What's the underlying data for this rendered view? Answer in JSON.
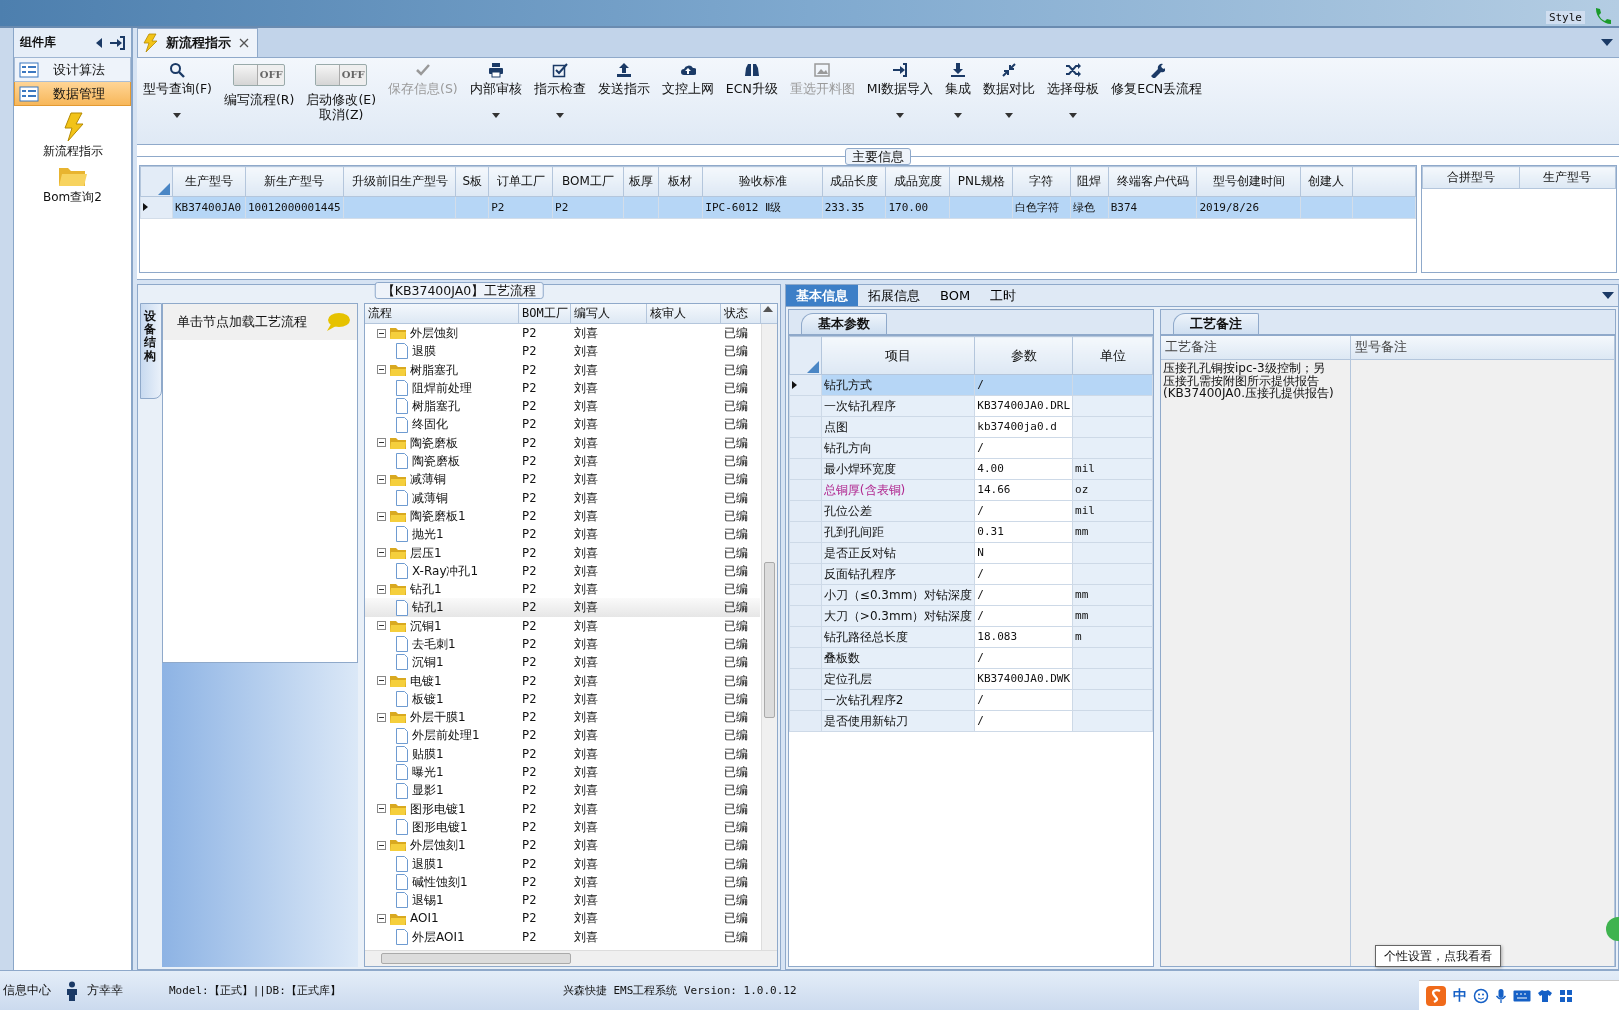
{
  "top_bar": {
    "style_label": "Style"
  },
  "sidebar": {
    "title": "组件库",
    "items": [
      {
        "label": "设计算法",
        "selected": false
      },
      {
        "label": "数据管理",
        "selected": true
      }
    ],
    "shortcuts": [
      {
        "label": "新流程指示"
      },
      {
        "label": "Bom查询2"
      }
    ]
  },
  "document_tab": {
    "title": "新流程指示"
  },
  "toolbar": [
    {
      "kind": "button",
      "label": "型号查询(F)",
      "dropdown": true,
      "disabled": false
    },
    {
      "kind": "toggle",
      "label": "编写流程(R)",
      "on": false,
      "toggle_text": "OFF"
    },
    {
      "kind": "toggle",
      "label": "启动修改(E)",
      "label_2": "取消(Z)",
      "on": false,
      "toggle_text": "OFF"
    },
    {
      "kind": "button",
      "label": "保存信息(S)",
      "dropdown": false,
      "disabled": true
    },
    {
      "kind": "button",
      "label": "内部审核",
      "dropdown": true,
      "disabled": false
    },
    {
      "kind": "button",
      "label": "指示检查",
      "dropdown": true,
      "disabled": false
    },
    {
      "kind": "button",
      "label": "发送指示",
      "dropdown": false,
      "disabled": false
    },
    {
      "kind": "button",
      "label": "文控上网",
      "dropdown": false,
      "disabled": false
    },
    {
      "kind": "button",
      "label": "ECN升级",
      "dropdown": false,
      "disabled": false
    },
    {
      "kind": "button",
      "label": "重选开料图",
      "dropdown": false,
      "disabled": true
    },
    {
      "kind": "button",
      "label": "MI数据导入",
      "dropdown": true,
      "disabled": false
    },
    {
      "kind": "button",
      "label": "集成",
      "dropdown": true,
      "disabled": false
    },
    {
      "kind": "button",
      "label": "数据对比",
      "dropdown": true,
      "disabled": false
    },
    {
      "kind": "button",
      "label": "选择母板",
      "dropdown": true,
      "disabled": false
    },
    {
      "kind": "button",
      "label": "修复ECN丢流程",
      "dropdown": false,
      "disabled": false
    }
  ],
  "main_info": {
    "title": "主要信息",
    "table": {
      "columns": [
        "生产型号",
        "新生产型号",
        "升级前旧生产型号",
        "S板",
        "订单工厂",
        "BOM工厂",
        "板厚",
        "板材",
        "验收标准",
        "成品长度",
        "成品宽度",
        "PNL规格",
        "字符",
        "阻焊",
        "终端客户代码",
        "型号创建时间",
        "创建人"
      ],
      "rows": [
        {
          "selected": true,
          "cells": [
            "KB37400JA0",
            "10012000001445",
            null,
            null,
            "P2",
            "P2",
            null,
            null,
            "IPC-6012 Ⅱ级",
            "233.35",
            "170.00",
            null,
            "白色字符",
            "绿色",
            "B374",
            "2019/8/26",
            null
          ]
        }
      ]
    },
    "merge_table": {
      "columns": [
        "合拼型号",
        "生产型号"
      ]
    }
  },
  "process_panel": {
    "title": "【KB37400JA0】工艺流程",
    "side_tab": "设备结构",
    "hint": "单击节点加载工艺流程",
    "tree": {
      "columns": [
        "流程",
        "BOM工厂",
        "编写人",
        "核审人",
        "状态"
      ],
      "nodes": [
        {
          "name": "外层蚀刻",
          "bom_factory": "P2",
          "writer": "刘喜",
          "status": "已编",
          "expanded": true,
          "selected": false,
          "children": [
            {
              "name": "退膜",
              "bom_factory": "P2",
              "writer": "刘喜",
              "status": "已编",
              "selected": false
            }
          ]
        },
        {
          "name": "树脂塞孔",
          "bom_factory": "P2",
          "writer": "刘喜",
          "status": "已编",
          "expanded": true,
          "selected": false,
          "children": [
            {
              "name": "阻焊前处理",
              "bom_factory": "P2",
              "writer": "刘喜",
              "status": "已编",
              "selected": false
            },
            {
              "name": "树脂塞孔",
              "bom_factory": "P2",
              "writer": "刘喜",
              "status": "已编",
              "selected": false
            },
            {
              "name": "终固化",
              "bom_factory": "P2",
              "writer": "刘喜",
              "status": "已编",
              "selected": false
            }
          ]
        },
        {
          "name": "陶瓷磨板",
          "bom_factory": "P2",
          "writer": "刘喜",
          "status": "已编",
          "expanded": true,
          "selected": false,
          "children": [
            {
              "name": "陶瓷磨板",
              "bom_factory": "P2",
              "writer": "刘喜",
              "status": "已编",
              "selected": false
            }
          ]
        },
        {
          "name": "减薄铜",
          "bom_factory": "P2",
          "writer": "刘喜",
          "status": "已编",
          "expanded": true,
          "selected": false,
          "children": [
            {
              "name": "减薄铜",
              "bom_factory": "P2",
              "writer": "刘喜",
              "status": "已编",
              "selected": false
            }
          ]
        },
        {
          "name": "陶瓷磨板1",
          "bom_factory": "P2",
          "writer": "刘喜",
          "status": "已编",
          "expanded": true,
          "selected": false,
          "children": [
            {
              "name": "抛光1",
              "bom_factory": "P2",
              "writer": "刘喜",
              "status": "已编",
              "selected": false
            }
          ]
        },
        {
          "name": "层压1",
          "bom_factory": "P2",
          "writer": "刘喜",
          "status": "已编",
          "expanded": true,
          "selected": false,
          "children": [
            {
              "name": "X-Ray冲孔1",
              "bom_factory": "P2",
              "writer": "刘喜",
              "status": "已编",
              "selected": false
            }
          ]
        },
        {
          "name": "钻孔1",
          "bom_factory": "P2",
          "writer": "刘喜",
          "status": "已编",
          "expanded": true,
          "selected": false,
          "children": [
            {
              "name": "钻孔1",
              "bom_factory": "P2",
              "writer": "刘喜",
              "status": "已编",
              "selected": true
            }
          ]
        },
        {
          "name": "沉铜1",
          "bom_factory": "P2",
          "writer": "刘喜",
          "status": "已编",
          "expanded": true,
          "selected": false,
          "children": [
            {
              "name": "去毛刺1",
              "bom_factory": "P2",
              "writer": "刘喜",
              "status": "已编",
              "selected": false
            },
            {
              "name": "沉铜1",
              "bom_factory": "P2",
              "writer": "刘喜",
              "status": "已编",
              "selected": false
            }
          ]
        },
        {
          "name": "电镀1",
          "bom_factory": "P2",
          "writer": "刘喜",
          "status": "已编",
          "expanded": true,
          "selected": false,
          "children": [
            {
              "name": "板镀1",
              "bom_factory": "P2",
              "writer": "刘喜",
              "status": "已编",
              "selected": false
            }
          ]
        },
        {
          "name": "外层干膜1",
          "bom_factory": "P2",
          "writer": "刘喜",
          "status": "已编",
          "expanded": true,
          "selected": false,
          "children": [
            {
              "name": "外层前处理1",
              "bom_factory": "P2",
              "writer": "刘喜",
              "status": "已编",
              "selected": false
            },
            {
              "name": "贴膜1",
              "bom_factory": "P2",
              "writer": "刘喜",
              "status": "已编",
              "selected": false
            },
            {
              "name": "曝光1",
              "bom_factory": "P2",
              "writer": "刘喜",
              "status": "已编",
              "selected": false
            },
            {
              "name": "显影1",
              "bom_factory": "P2",
              "writer": "刘喜",
              "status": "已编",
              "selected": false
            }
          ]
        },
        {
          "name": "图形电镀1",
          "bom_factory": "P2",
          "writer": "刘喜",
          "status": "已编",
          "expanded": true,
          "selected": false,
          "children": [
            {
              "name": "图形电镀1",
              "bom_factory": "P2",
              "writer": "刘喜",
              "status": "已编",
              "selected": false
            }
          ]
        },
        {
          "name": "外层蚀刻1",
          "bom_factory": "P2",
          "writer": "刘喜",
          "status": "已编",
          "expanded": true,
          "selected": false,
          "children": [
            {
              "name": "退膜1",
              "bom_factory": "P2",
              "writer": "刘喜",
              "status": "已编",
              "selected": false
            },
            {
              "name": "碱性蚀刻1",
              "bom_factory": "P2",
              "writer": "刘喜",
              "status": "已编",
              "selected": false
            },
            {
              "name": "退锡1",
              "bom_factory": "P2",
              "writer": "刘喜",
              "status": "已编",
              "selected": false
            }
          ]
        },
        {
          "name": "AOI1",
          "bom_factory": "P2",
          "writer": "刘喜",
          "status": "已编",
          "expanded": true,
          "selected": false,
          "children": [
            {
              "name": "外层AOI1",
              "bom_factory": "P2",
              "writer": "刘喜",
              "status": "已编",
              "selected": false
            }
          ]
        }
      ]
    }
  },
  "detail_tabs": [
    {
      "label": "基本信息",
      "selected": true
    },
    {
      "label": "拓展信息",
      "selected": false
    },
    {
      "label": "BOM",
      "selected": false
    },
    {
      "label": "工时",
      "selected": false
    }
  ],
  "parameters": {
    "tab_title": "基本参数",
    "columns": [
      "项目",
      "参数",
      "单位"
    ],
    "rows": [
      {
        "item": "钻孔方式",
        "value": "/",
        "selected": true,
        "emphasized": false
      },
      {
        "item": "一次钻孔程序",
        "value": "KB37400JA0.DRL",
        "selected": false,
        "emphasized": false
      },
      {
        "item": "点图",
        "value": "kb37400ja0.d",
        "selected": false,
        "emphasized": false
      },
      {
        "item": "钻孔方向",
        "value": "/",
        "selected": false,
        "emphasized": false
      },
      {
        "item": "最小焊环宽度",
        "value": "4.00",
        "unit": "mil",
        "selected": false,
        "emphasized": false
      },
      {
        "item": "总铜厚(含表铜)",
        "value": "14.66",
        "unit": "oz",
        "selected": false,
        "emphasized": true
      },
      {
        "item": "孔位公差",
        "value": "/",
        "unit": "mil",
        "selected": false,
        "emphasized": false
      },
      {
        "item": "孔到孔间距",
        "value": "0.31",
        "unit": "mm",
        "selected": false,
        "emphasized": false
      },
      {
        "item": "是否正反对钻",
        "value": "N",
        "selected": false,
        "emphasized": false
      },
      {
        "item": "反面钻孔程序",
        "value": "/",
        "selected": false,
        "emphasized": false
      },
      {
        "item": "小刀（≤0.3mm）对钻深度",
        "value": "/",
        "unit": "mm",
        "selected": false,
        "emphasized": false
      },
      {
        "item": "大刀（>0.3mm）对钻深度",
        "value": "/",
        "unit": "mm",
        "selected": false,
        "emphasized": false
      },
      {
        "item": "钻孔路径总长度",
        "value": "18.083",
        "unit": "m",
        "selected": false,
        "emphasized": false
      },
      {
        "item": "叠板数",
        "value": "/",
        "selected": false,
        "emphasized": false
      },
      {
        "item": "定位孔层",
        "value": "KB37400JA0.DWK",
        "selected": false,
        "emphasized": false
      },
      {
        "item": "一次钻孔程序2",
        "value": "/",
        "selected": false,
        "emphasized": false
      },
      {
        "item": "是否使用新钻刀",
        "value": "/",
        "selected": false,
        "emphasized": false
      }
    ]
  },
  "remarks": {
    "tab_title": "工艺备注",
    "columns": [
      "工艺备注",
      "型号备注"
    ],
    "process_note": "压接孔孔铜按ipc-3级控制；另压接孔需按附图所示提供报告(KB37400JA0.压接孔提供报告)"
  },
  "status_bar": {
    "info_center": "信息中心",
    "user": "方幸幸",
    "environment": "Model:【正式】||DB:【正式库】",
    "app_version": "兴森快捷 EMS工程系统 Version: 1.0.0.12",
    "tooltip": "个性设置，点我看看",
    "ime_mode": "中"
  }
}
